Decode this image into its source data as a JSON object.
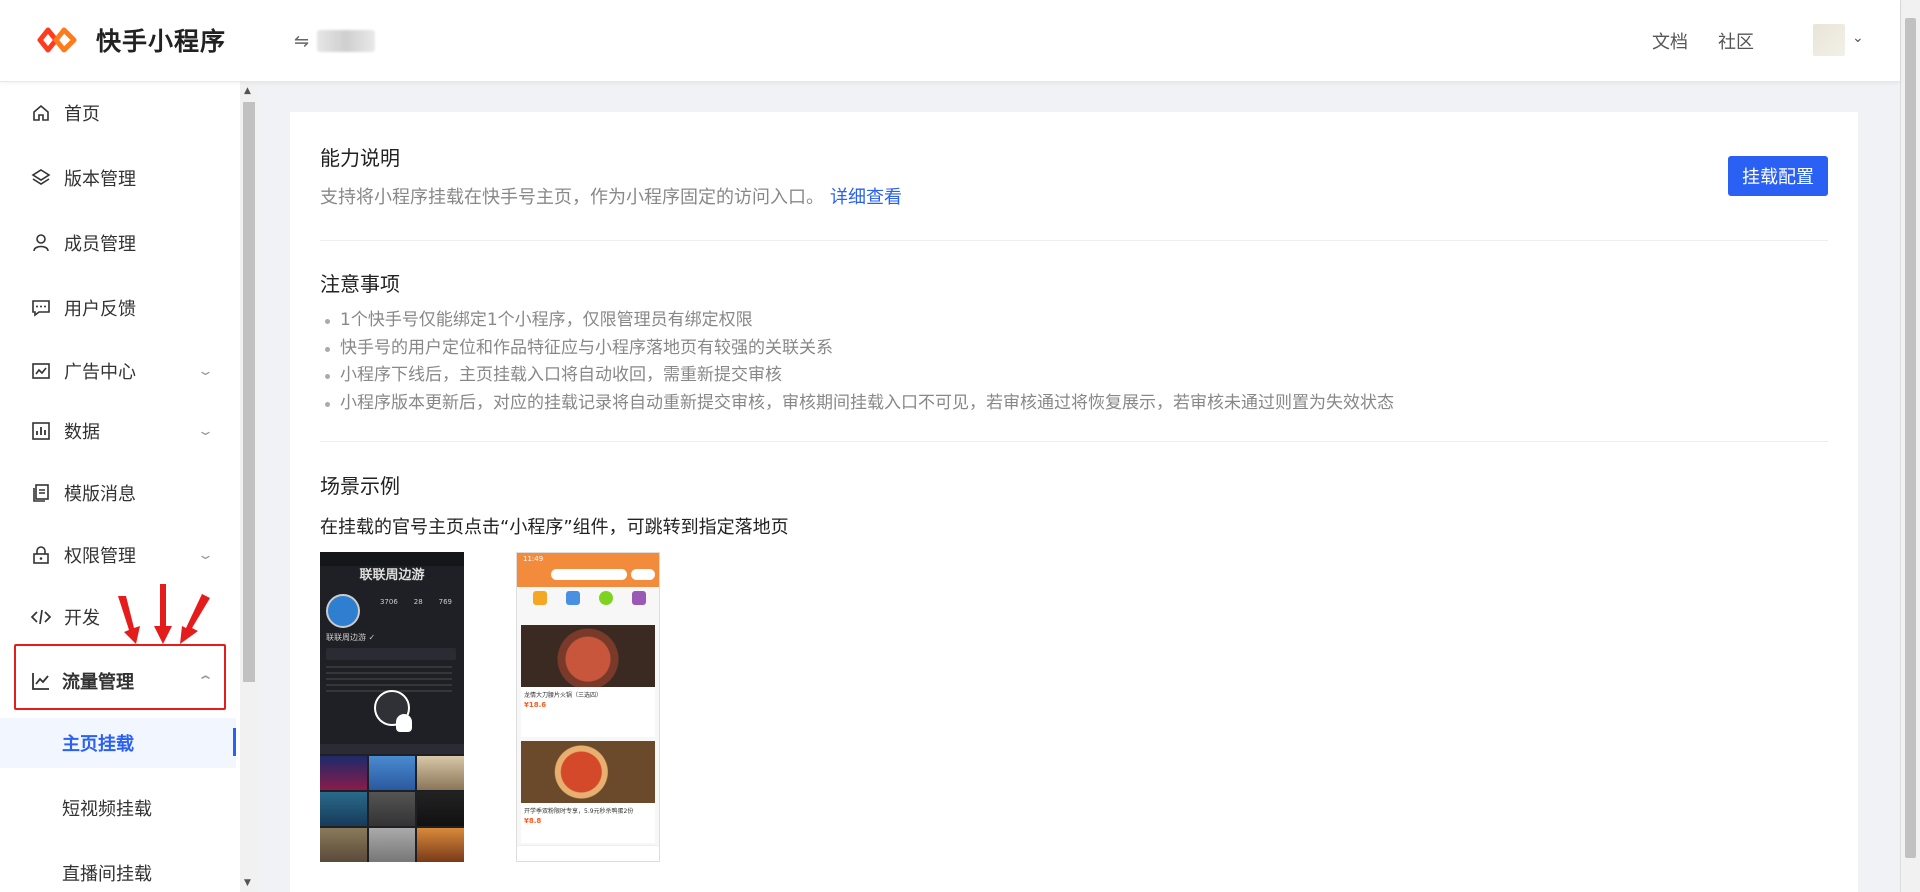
{
  "header": {
    "app_name": "快手小程序",
    "switch_icon": "⇋",
    "links": [
      "文档",
      "社区"
    ]
  },
  "sidebar": {
    "items": [
      {
        "label": "首页",
        "icon": "home-icon"
      },
      {
        "label": "版本管理",
        "icon": "layers-icon"
      },
      {
        "label": "成员管理",
        "icon": "user-icon"
      },
      {
        "label": "用户反馈",
        "icon": "message-icon"
      },
      {
        "label": "广告中心",
        "icon": "ad-chart-icon"
      },
      {
        "label": "数据",
        "icon": "bar-chart-icon"
      },
      {
        "label": "模版消息",
        "icon": "copy-icon"
      },
      {
        "label": "权限管理",
        "icon": "lock-icon"
      },
      {
        "label": "开发",
        "icon": "code-icon"
      },
      {
        "label": "流量管理",
        "icon": "line-chart-icon"
      }
    ],
    "sub_items": [
      "主页挂载",
      "短视频挂载",
      "直播间挂载"
    ]
  },
  "main": {
    "capability": {
      "title": "能力说明",
      "desc": "支持将小程序挂载在快手号主页，作为小程序固定的访问入口。",
      "link": "详细查看",
      "button": "挂载配置"
    },
    "notes": {
      "title": "注意事项",
      "items": [
        "1个快手号仅能绑定1个小程序，仅限管理员有绑定权限",
        "快手号的用户定位和作品特征应与小程序落地页有较强的关联关系",
        "小程序下线后，主页挂载入口将自动收回，需重新提交审核",
        "小程序版本更新后，对应的挂载记录将自动重新提交审核，审核期间挂载入口不可见，若审核通过将恢复展示，若审核未通过则置为失效状态"
      ]
    },
    "scene": {
      "title": "场景示例",
      "subtitle": "在挂载的官号主页点击“小程序”组件，可跳转到指定落地页",
      "phone1": {
        "title": "联联周边游",
        "stats": [
          "3706",
          "28",
          "769"
        ],
        "name": "联联周边游 ✓"
      },
      "phone2": {
        "time": "11:49",
        "product1": "龙情大刀腰片火锅（三选四）",
        "price1": "¥18.6",
        "product2": "开学季双粉限时专享，5.9元秒杀鸭蛋2份",
        "price2": "¥8.8"
      }
    }
  },
  "colors": {
    "accent": "#2b60f5",
    "highlight_red": "#e41c1c",
    "logo_orange": "#fe3b1f"
  }
}
